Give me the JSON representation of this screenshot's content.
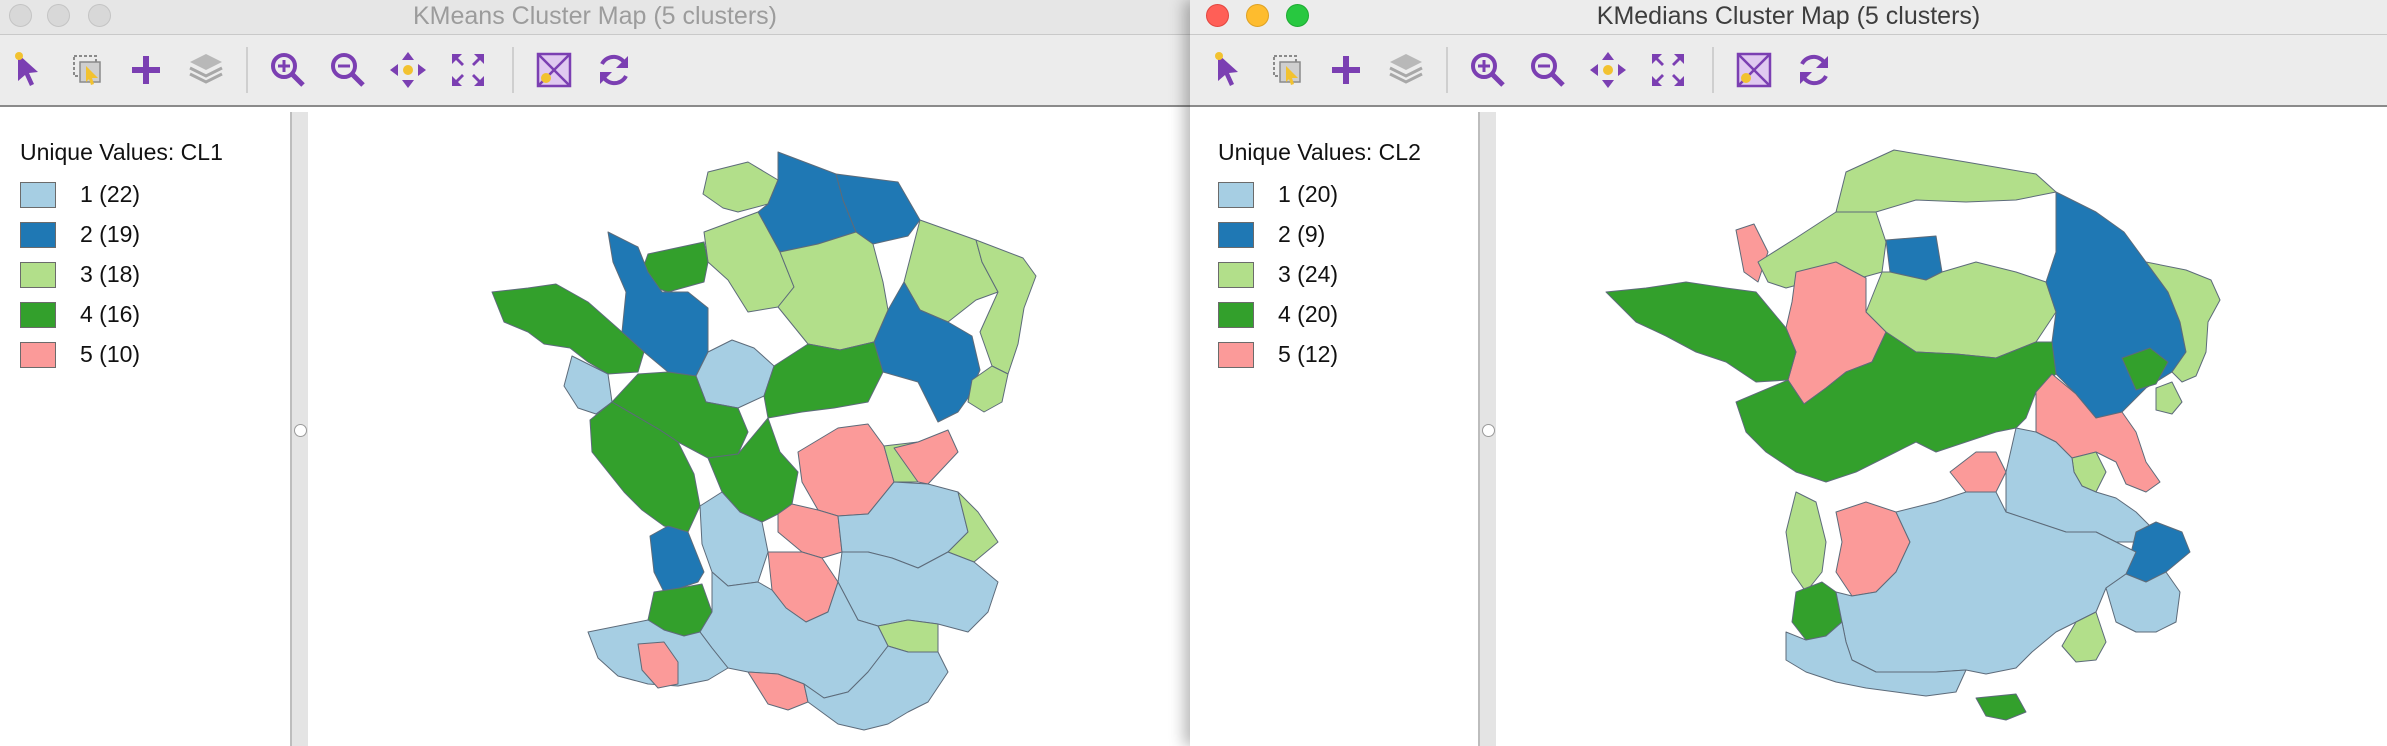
{
  "colors": {
    "cluster_1": "#a6cee3",
    "cluster_2": "#1f78b4",
    "cluster_3": "#b2df8a",
    "cluster_4": "#33a02c",
    "cluster_5": "#fb9a99",
    "toolbar_icon": "#7b3fb2",
    "close_light": "#ff5f57",
    "minimize_light": "#febc2e",
    "zoom_light": "#28c840",
    "inactive_light": "#d8d8d8"
  },
  "toolbar": {
    "icons": [
      "select-pointer-icon",
      "select-rectangle-icon",
      "add-icon",
      "layers-icon",
      "zoom-in-icon",
      "zoom-out-icon",
      "pan-icon",
      "fit-to-extent-icon",
      "clear-selection-icon",
      "refresh-icon"
    ]
  },
  "left": {
    "title": "KMeans Cluster Map (5 clusters)",
    "legend": {
      "title": "Unique Values: CL1",
      "items": [
        {
          "label": "1 (22)",
          "color": "#a6cee3"
        },
        {
          "label": "2 (19)",
          "color": "#1f78b4"
        },
        {
          "label": "3 (18)",
          "color": "#b2df8a"
        },
        {
          "label": "4 (16)",
          "color": "#33a02c"
        },
        {
          "label": "5 (10)",
          "color": "#fb9a99"
        }
      ]
    }
  },
  "right": {
    "title": "KMedians Cluster Map (5 clusters)",
    "legend": {
      "title": "Unique Values: CL2",
      "items": [
        {
          "label": "1 (20)",
          "color": "#a6cee3"
        },
        {
          "label": "2 (9)",
          "color": "#1f78b4"
        },
        {
          "label": "3 (24)",
          "color": "#b2df8a"
        },
        {
          "label": "4 (20)",
          "color": "#33a02c"
        },
        {
          "label": "5 (12)",
          "color": "#fb9a99"
        }
      ]
    }
  }
}
